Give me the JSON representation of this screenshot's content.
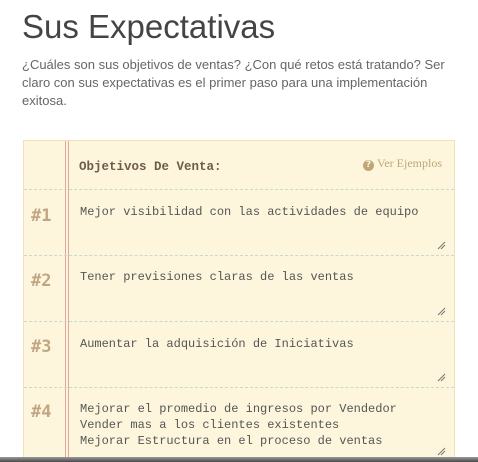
{
  "section": {
    "title": "Sus Expectativas",
    "intro": "¿Cuáles son sus objetivos de ventas? ¿Con qué retos está tratando? Ser claro con sus expectativas es el primer paso para una implementación exitosa."
  },
  "notepad": {
    "header_label": "Objetivos De Venta:",
    "examples_link": "Ver Ejemplos",
    "examples_icon": "question-circle-icon",
    "goals": [
      {
        "number": "#1",
        "text": "Mejor visibilidad con las actividades de equipo"
      },
      {
        "number": "#2",
        "text": "Tener previsiones claras de las ventas"
      },
      {
        "number": "#3",
        "text": "Aumentar la adquisición de Iniciativas"
      },
      {
        "number": "#4",
        "text": "Mejorar el promedio de ingresos por Vendedor\nVender mas a los clientes existentes\nMejorar Estructura en el proceso de ventas"
      }
    ]
  },
  "colors": {
    "paper": "#fdf6dc",
    "margin_line": "#e2a69a",
    "rule_line": "#c9d8cf",
    "number_color": "#c2a684",
    "link_color": "#c0a779"
  }
}
